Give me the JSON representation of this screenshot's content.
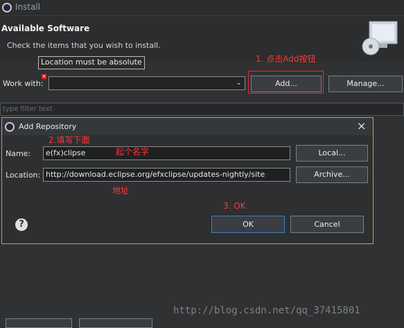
{
  "window": {
    "title": "Install"
  },
  "header": {
    "title": "Available Software",
    "subtitle": "Check the items that you wish to install."
  },
  "tooltip": "Location must be absolute",
  "work_with": {
    "label": "Work with:",
    "value": ""
  },
  "buttons": {
    "add": "Add...",
    "manage": "Manage..."
  },
  "filter": {
    "placeholder": "type filter text"
  },
  "dialog": {
    "title": "Add Repository",
    "name_label": "Name:",
    "name_value": "e(fx)clipse",
    "location_label": "Location:",
    "location_value": "http://download.eclipse.org/efxclipse/updates-nightly/site",
    "local_button": "Local...",
    "archive_button": "Archive...",
    "ok_button": "OK",
    "cancel_button": "Cancel",
    "help_glyph": "?"
  },
  "annotations": {
    "step1": "1. 点击Add按钮",
    "step2": "2.填写下面",
    "name_hint": "起个名字",
    "address_hint": "地址",
    "step3": "3. OK"
  },
  "watermark": "http://blog.csdn.net/qq_37415801",
  "colors": {
    "annotation": "#ff3838",
    "dialog_border": "#c6a33a"
  }
}
